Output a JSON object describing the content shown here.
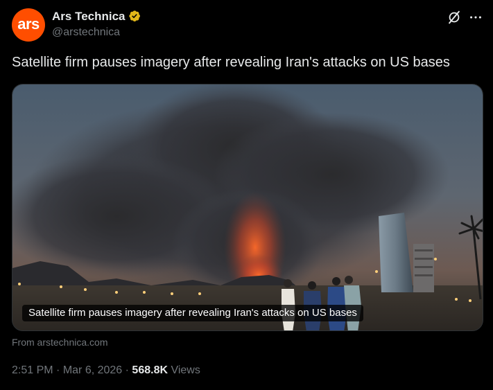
{
  "author": {
    "avatar_text": "ars",
    "display_name": "Ars Technica",
    "handle": "@arstechnica",
    "verified": true,
    "avatar_color": "#ff4e00",
    "badge_color": "#e2b719"
  },
  "actions": {
    "grok_icon": "grok-slash-icon",
    "more_icon": "more-dots-icon"
  },
  "tweet": {
    "text": "Satellite firm pauses imagery after revealing Iran's attacks on US bases"
  },
  "card": {
    "caption": "Satellite firm pauses imagery after revealing Iran's attacks on US bases",
    "source": "From arstechnica.com"
  },
  "meta": {
    "time": "2:51 PM",
    "sep1": " · ",
    "date": "Mar 6, 2026",
    "sep2": " · ",
    "views_count": "568.8K",
    "views_label": " Views"
  },
  "colors": {
    "background": "#000000",
    "text": "#e7e9ea",
    "muted": "#71767b"
  }
}
